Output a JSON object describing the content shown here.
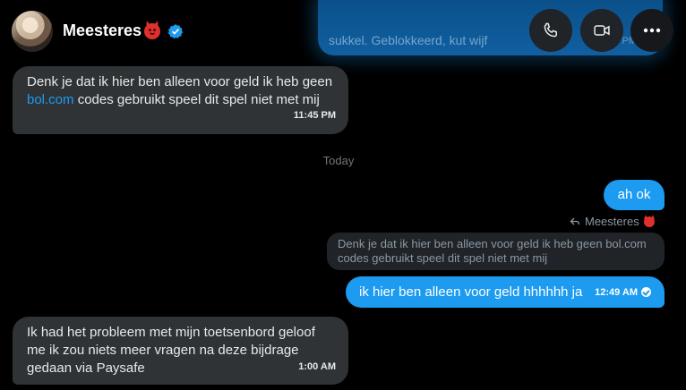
{
  "header": {
    "name": "Meesteres",
    "preview_text": "sukkel. Geblokkeerd, kut wijf",
    "preview_time": "2:59 PM",
    "icons": [
      "devil-emoji",
      "verified-badge",
      "phone-icon",
      "video-icon",
      "more-icon"
    ]
  },
  "messages": [
    {
      "part1": "Denk je dat ik hier ben alleen voor geld ik heb geen ",
      "link": "bol.com",
      "part2": " codes gebruikt speel dit spel niet met mij",
      "time": "11:45 PM"
    }
  ],
  "day_separator": "Today",
  "outgoing1": {
    "text": "ah ok"
  },
  "reply": {
    "label": "Meesteres",
    "quoted_text": "Denk je dat ik hier ben alleen voor geld ik heb geen bol.com codes gebruikt speel dit spel niet met mij"
  },
  "outgoing2": {
    "text": "ik hier ben alleen voor geld hhhhhh ja",
    "time": "12:49 AM"
  },
  "incoming2": {
    "text": "Ik had het probleem met mijn toetsenbord geloof me ik zou niets meer vragen na deze bijdrage gedaan via Paysafe",
    "time": "1:00 AM"
  },
  "colors": {
    "accent": "#1d9bf0",
    "bubble_in": "#2f3336",
    "background": "#000000"
  }
}
